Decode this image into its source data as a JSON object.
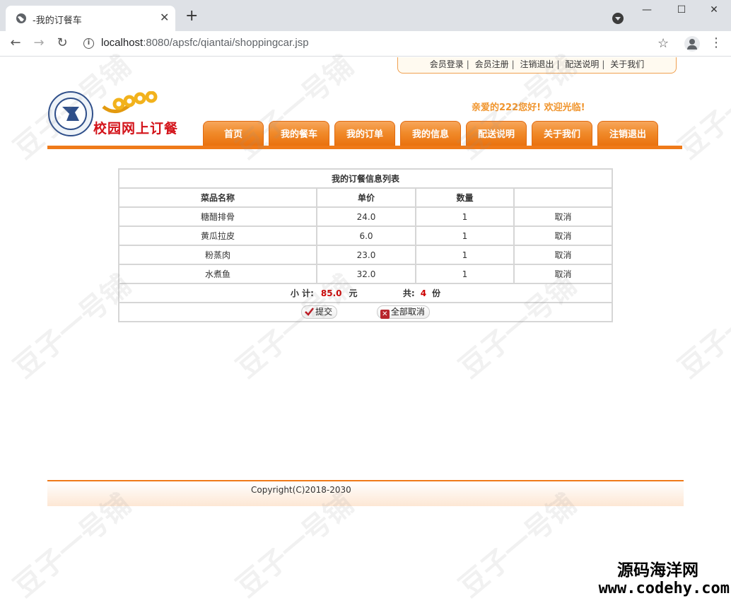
{
  "browser": {
    "tab_title": "-我的订餐车",
    "url_host": "localhost",
    "url_rest": ":8080/apsfc/qiantai/shoppingcar.jsp"
  },
  "toplinks": [
    "会员登录",
    "会员注册",
    "注销退出",
    "配送说明",
    "关于我们"
  ],
  "logo_text": "校园网上订餐",
  "welcome": "亲爱的222您好!  欢迎光临!",
  "menu": [
    "首页",
    "我的餐车",
    "我的订单",
    "我的信息",
    "配送说明",
    "关于我们",
    "注销退出"
  ],
  "orders": {
    "title": "我的订餐信息列表",
    "headers": [
      "菜品名称",
      "单价",
      "数量",
      ""
    ],
    "rows": [
      {
        "name": "糖醋排骨",
        "price": "24.0",
        "qty": "1",
        "action": "取消"
      },
      {
        "name": "黄瓜拉皮",
        "price": "6.0",
        "qty": "1",
        "action": "取消"
      },
      {
        "name": "粉蒸肉",
        "price": "23.0",
        "qty": "1",
        "action": "取消"
      },
      {
        "name": "水煮鱼",
        "price": "32.0",
        "qty": "1",
        "action": "取消"
      }
    ],
    "subtotal_label": "小 计:",
    "subtotal_value": "85.0",
    "currency": "元",
    "total_label": "共:",
    "total_count": "4",
    "count_unit": "份",
    "submit_label": "提交",
    "cancel_all_label": "全部取消"
  },
  "footer": "Copyright(C)2018-2030",
  "watermark": "豆子一号铺",
  "brand_line1": "源码海洋网",
  "brand_line2": "www.codehy.com",
  "colors": {
    "accent": "#ef7a19",
    "price": "#cc0000",
    "welcome": "#f0942c"
  }
}
